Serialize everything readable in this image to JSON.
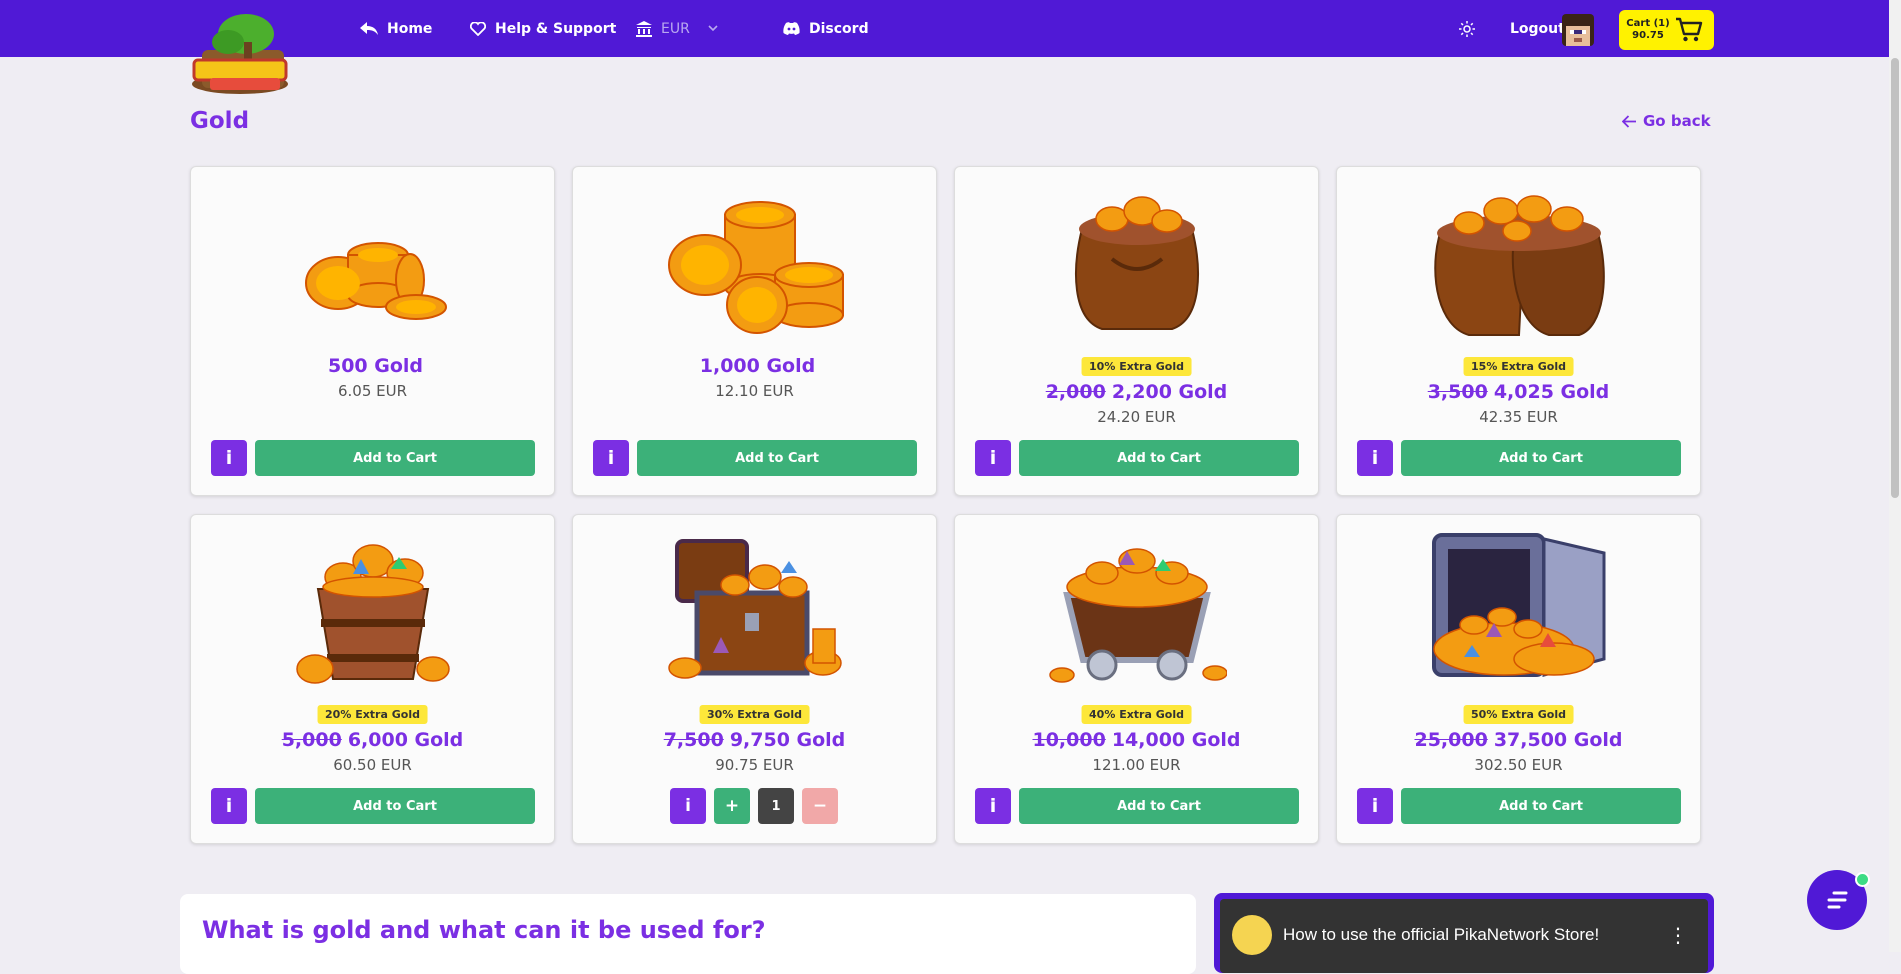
{
  "nav": {
    "home": "Home",
    "help": "Help & Support",
    "currency": "EUR",
    "discord": "Discord",
    "logout": "Logout",
    "cart_line1": "Cart (1)",
    "cart_line2": "90.75"
  },
  "page": {
    "title": "Gold",
    "go_back": "Go back"
  },
  "products": [
    {
      "badge": "",
      "old": "",
      "name": "500 Gold",
      "price": "6.05 EUR",
      "button": "Add to Cart",
      "info": "i"
    },
    {
      "badge": "",
      "old": "",
      "name": "1,000 Gold",
      "price": "12.10 EUR",
      "button": "Add to Cart",
      "info": "i"
    },
    {
      "badge": "10% Extra Gold",
      "old": "2,000",
      "name": "2,200 Gold",
      "price": "24.20 EUR",
      "button": "Add to Cart",
      "info": "i"
    },
    {
      "badge": "15% Extra Gold",
      "old": "3,500",
      "name": "4,025 Gold",
      "price": "42.35 EUR",
      "button": "Add to Cart",
      "info": "i"
    },
    {
      "badge": "20% Extra Gold",
      "old": "5,000",
      "name": "6,000 Gold",
      "price": "60.50 EUR",
      "button": "Add to Cart",
      "info": "i"
    },
    {
      "badge": "30% Extra Gold",
      "old": "7,500",
      "name": "9,750 Gold",
      "price": "90.75 EUR",
      "button": "",
      "info": "i",
      "qty": "1",
      "plus": "+",
      "minus": "−"
    },
    {
      "badge": "40% Extra Gold",
      "old": "10,000",
      "name": "14,000 Gold",
      "price": "121.00 EUR",
      "button": "Add to Cart",
      "info": "i"
    },
    {
      "badge": "50% Extra Gold",
      "old": "25,000",
      "name": "37,500 Gold",
      "price": "302.50 EUR",
      "button": "Add to Cart",
      "info": "i"
    }
  ],
  "about": {
    "title": "What is gold and what can it be used for?"
  },
  "video": {
    "title": "How to use the official PikaNetwork Store!",
    "menu": "⋮"
  },
  "colors": {
    "nav_bg": "#5019d6",
    "accent": "#7b2fe3",
    "add_button": "#3cb179",
    "cart_bg": "#fff200",
    "badge": "#fde73a"
  }
}
